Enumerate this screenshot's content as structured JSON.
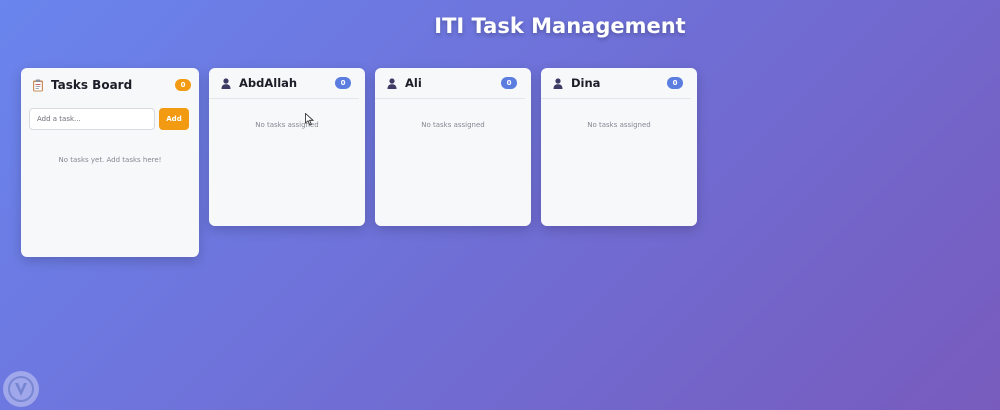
{
  "header": {
    "title": "ITI Task Management"
  },
  "tasks_board": {
    "title": "Tasks Board",
    "count": "0",
    "input_placeholder": "Add a task...",
    "add_label": "Add",
    "empty_message": "No tasks yet. Add tasks here!"
  },
  "members": [
    {
      "name": "AbdAllah",
      "count": "0",
      "empty_message": "No tasks assigned"
    },
    {
      "name": "Ali",
      "count": "0",
      "empty_message": "No tasks assigned"
    },
    {
      "name": "Dina",
      "count": "0",
      "empty_message": "No tasks assigned"
    }
  ],
  "icons": {
    "board": "clipboard-icon",
    "member": "user-icon"
  },
  "colors": {
    "accent": "#f29b12",
    "member_badge": "#5b7de0"
  }
}
